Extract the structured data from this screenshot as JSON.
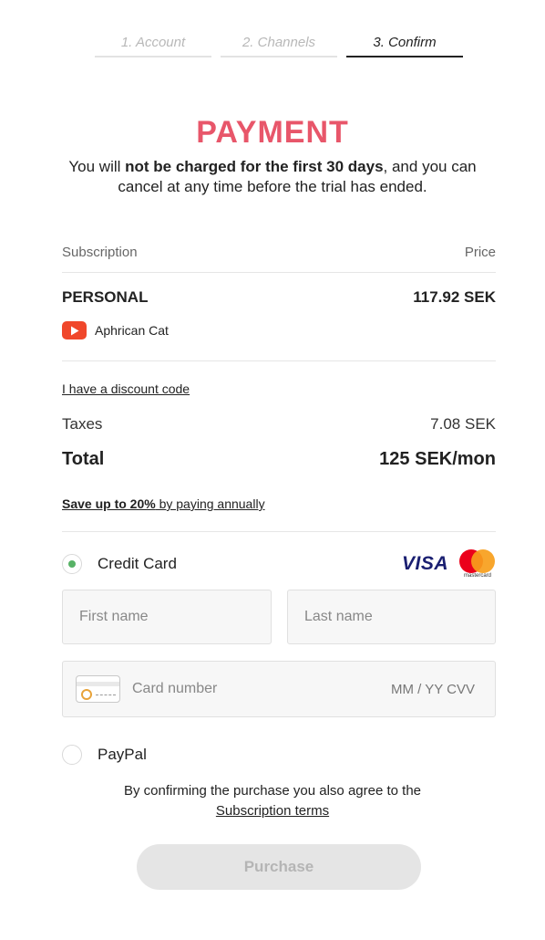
{
  "steps": [
    {
      "label": "1. Account",
      "active": false
    },
    {
      "label": "2. Channels",
      "active": false
    },
    {
      "label": "3. Confirm",
      "active": true
    }
  ],
  "header": {
    "title": "PAYMENT",
    "subtitle_pre": "You will ",
    "subtitle_bold": "not be charged for the first 30 days",
    "subtitle_post": ", and you can cancel at any time before the trial has ended."
  },
  "summary": {
    "col_subscription": "Subscription",
    "col_price": "Price",
    "plan_name": "PERSONAL",
    "plan_price": "117.92 SEK",
    "channel_icon": "youtube-icon",
    "channel_name": "Aphrican Cat",
    "discount_link": "I have a discount code",
    "taxes_label": "Taxes",
    "taxes_value": "7.08 SEK",
    "total_label": "Total",
    "total_value": "125 SEK/mon",
    "save_bold": "Save up to 20%",
    "save_rest": " by paying annually"
  },
  "payment": {
    "credit_card_label": "Credit Card",
    "credit_card_selected": true,
    "visa_label": "VISA",
    "mastercard_label": "mastercard",
    "first_name_placeholder": "First name",
    "last_name_placeholder": "Last name",
    "card_number_placeholder": "Card number",
    "card_expiry_placeholder": "MM / YY CVV",
    "paypal_label": "PayPal",
    "paypal_selected": false
  },
  "footer": {
    "terms_text": "By confirming the purchase you also agree to the",
    "terms_link": "Subscription terms",
    "purchase_label": "Purchase"
  },
  "colors": {
    "accent": "#e8566a",
    "radio_selected": "#57b266",
    "youtube": "#f0472b"
  }
}
